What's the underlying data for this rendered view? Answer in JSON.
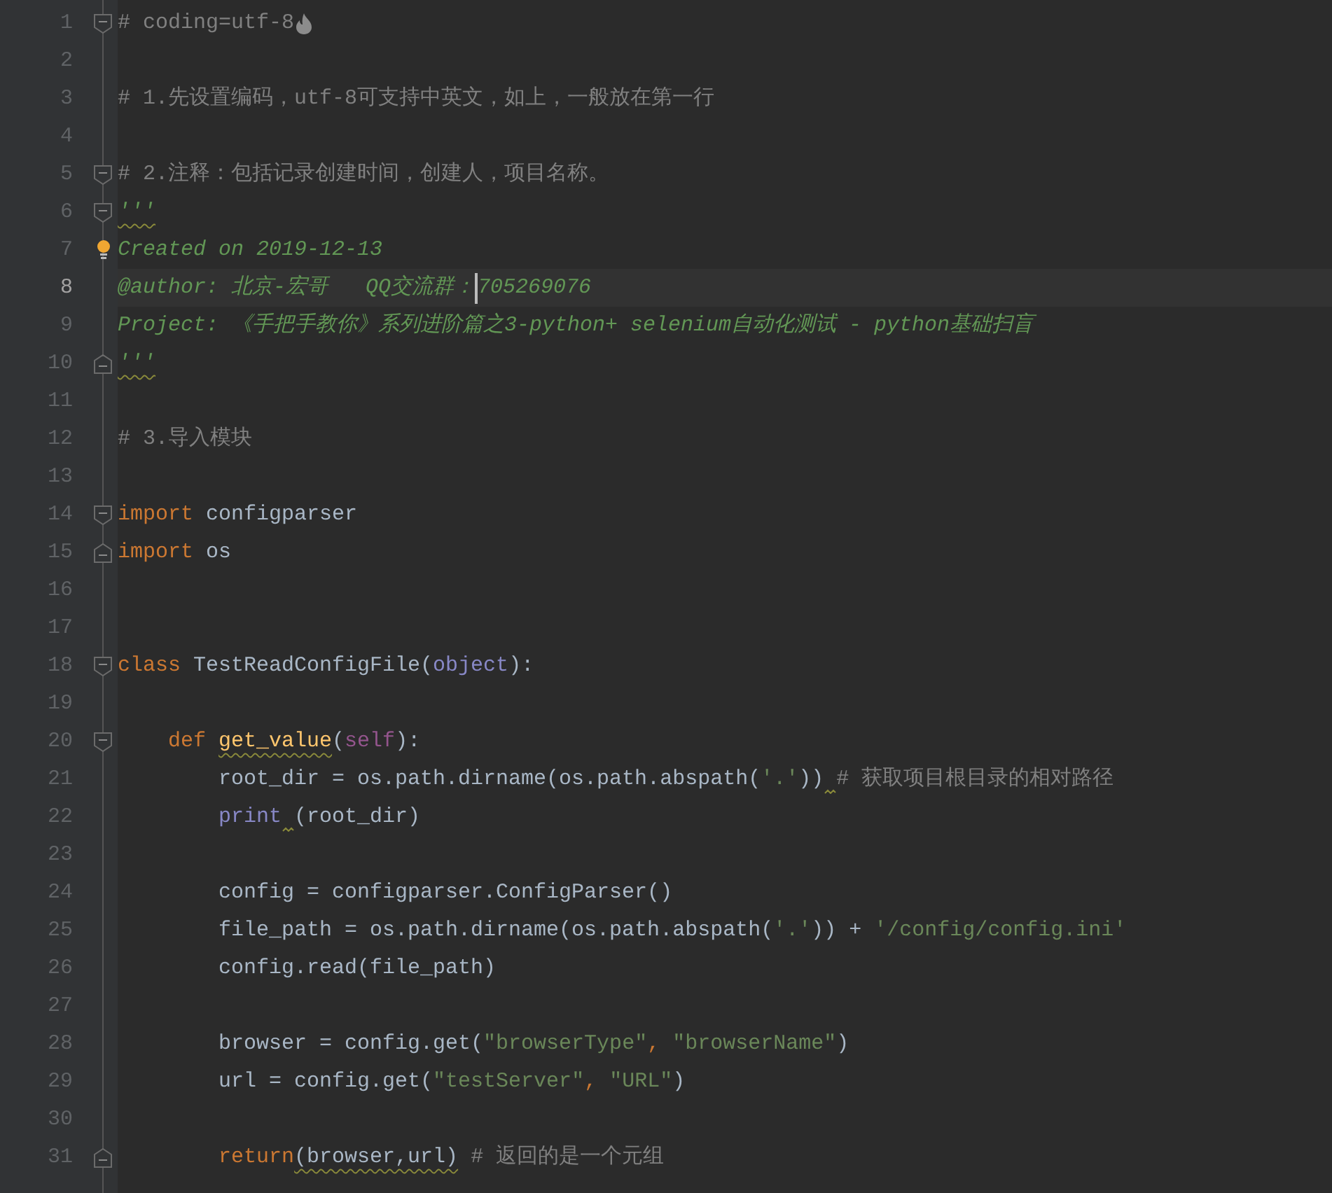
{
  "editor": {
    "lines": [
      {
        "number": "1",
        "fold_start": true,
        "trailing_icon": true,
        "tokens": [
          {
            "kind": "comment",
            "text": "# coding=utf-8"
          }
        ]
      },
      {
        "number": "2"
      },
      {
        "number": "3",
        "tokens": [
          {
            "kind": "comment",
            "text": "# 1.先设置编码，utf-8可支持中英文，如上，一般放在第一行"
          }
        ]
      },
      {
        "number": "4"
      },
      {
        "number": "5",
        "fold_start": true,
        "tokens": [
          {
            "kind": "comment",
            "text": "# 2.注释：包括记录创建时间，创建人，项目名称。"
          }
        ]
      },
      {
        "number": "6",
        "fold_start": true,
        "tokens": [
          {
            "kind": "doc",
            "text": "'''",
            "warning": true
          }
        ]
      },
      {
        "number": "7",
        "bulb": true,
        "tokens": [
          {
            "kind": "doc",
            "text": "Created on 2019-12-13"
          }
        ]
      },
      {
        "number": "8",
        "current": true,
        "tokens": [
          {
            "kind": "doc",
            "text": "@author: 北京-宏哥   QQ交流群："
          },
          {
            "kind": "doc",
            "text": "705269076",
            "caret": true
          }
        ]
      },
      {
        "number": "9",
        "tokens": [
          {
            "kind": "doc",
            "text": "Project: 《手把手教你》系列进阶篇之3-python+ selenium自动化测试 - python基础扫盲"
          }
        ]
      },
      {
        "number": "10",
        "fold_end": true,
        "tokens": [
          {
            "kind": "doc",
            "text": "'''",
            "warning": true
          }
        ]
      },
      {
        "number": "11"
      },
      {
        "number": "12",
        "tokens": [
          {
            "kind": "comment",
            "text": "# 3.导入模块"
          }
        ]
      },
      {
        "number": "13"
      },
      {
        "number": "14",
        "fold_start": true,
        "tokens": [
          {
            "kind": "keyword",
            "text": "import"
          },
          {
            "kind": "plain",
            "text": " configparser"
          }
        ]
      },
      {
        "number": "15",
        "fold_end": true,
        "tokens": [
          {
            "kind": "keyword",
            "text": "import"
          },
          {
            "kind": "plain",
            "text": " os"
          }
        ]
      },
      {
        "number": "16"
      },
      {
        "number": "17"
      },
      {
        "number": "18",
        "fold_start": true,
        "tokens": [
          {
            "kind": "keyword",
            "text": "class"
          },
          {
            "kind": "plain",
            "text": " TestReadConfigFile("
          },
          {
            "kind": "builtin",
            "text": "object"
          },
          {
            "kind": "plain",
            "text": "):"
          }
        ]
      },
      {
        "number": "19"
      },
      {
        "number": "20",
        "fold_start": true,
        "tokens": [
          {
            "kind": "keyword",
            "text": "    def "
          },
          {
            "kind": "function",
            "text": "get_value",
            "warning": true
          },
          {
            "kind": "plain",
            "text": "("
          },
          {
            "kind": "self",
            "text": "self"
          },
          {
            "kind": "plain",
            "text": "):"
          }
        ]
      },
      {
        "number": "21",
        "tokens": [
          {
            "kind": "plain",
            "text": "        root_dir = os.path.dirname(os.path.abspath("
          },
          {
            "kind": "string",
            "text": "'.'"
          },
          {
            "kind": "plain",
            "text": "))"
          },
          {
            "kind": "squiggle"
          },
          {
            "kind": "comment",
            "text": "# 获取项目根目录的相对路径"
          }
        ]
      },
      {
        "number": "22",
        "tokens": [
          {
            "kind": "builtin",
            "text": "        print"
          },
          {
            "kind": "squiggle"
          },
          {
            "kind": "plain",
            "text": "(root_dir)"
          }
        ]
      },
      {
        "number": "23"
      },
      {
        "number": "24",
        "tokens": [
          {
            "kind": "plain",
            "text": "        config = configparser.ConfigParser()"
          }
        ]
      },
      {
        "number": "25",
        "tokens": [
          {
            "kind": "plain",
            "text": "        file_path = os.path.dirname(os.path.abspath("
          },
          {
            "kind": "string",
            "text": "'.'"
          },
          {
            "kind": "plain",
            "text": ")) + "
          },
          {
            "kind": "string",
            "text": "'/config/config.ini'"
          }
        ]
      },
      {
        "number": "26",
        "tokens": [
          {
            "kind": "plain",
            "text": "        config.read(file_path)"
          }
        ]
      },
      {
        "number": "27"
      },
      {
        "number": "28",
        "tokens": [
          {
            "kind": "plain",
            "text": "        browser = config.get("
          },
          {
            "kind": "string",
            "text": "\"browserType\""
          },
          {
            "kind": "keyword",
            "text": ", "
          },
          {
            "kind": "string",
            "text": "\"browserName\""
          },
          {
            "kind": "plain",
            "text": ")"
          }
        ]
      },
      {
        "number": "29",
        "tokens": [
          {
            "kind": "plain",
            "text": "        url = config.get("
          },
          {
            "kind": "string",
            "text": "\"testServer\""
          },
          {
            "kind": "keyword",
            "text": ", "
          },
          {
            "kind": "string",
            "text": "\"URL\""
          },
          {
            "kind": "plain",
            "text": ")"
          }
        ]
      },
      {
        "number": "30"
      },
      {
        "number": "31",
        "fold_end": true,
        "tokens": [
          {
            "kind": "keyword",
            "text": "        return"
          },
          {
            "kind": "plain",
            "text": "(browser,url)",
            "warning": true
          },
          {
            "kind": "comment",
            "text": " # 返回的是一个元组"
          }
        ]
      }
    ]
  }
}
